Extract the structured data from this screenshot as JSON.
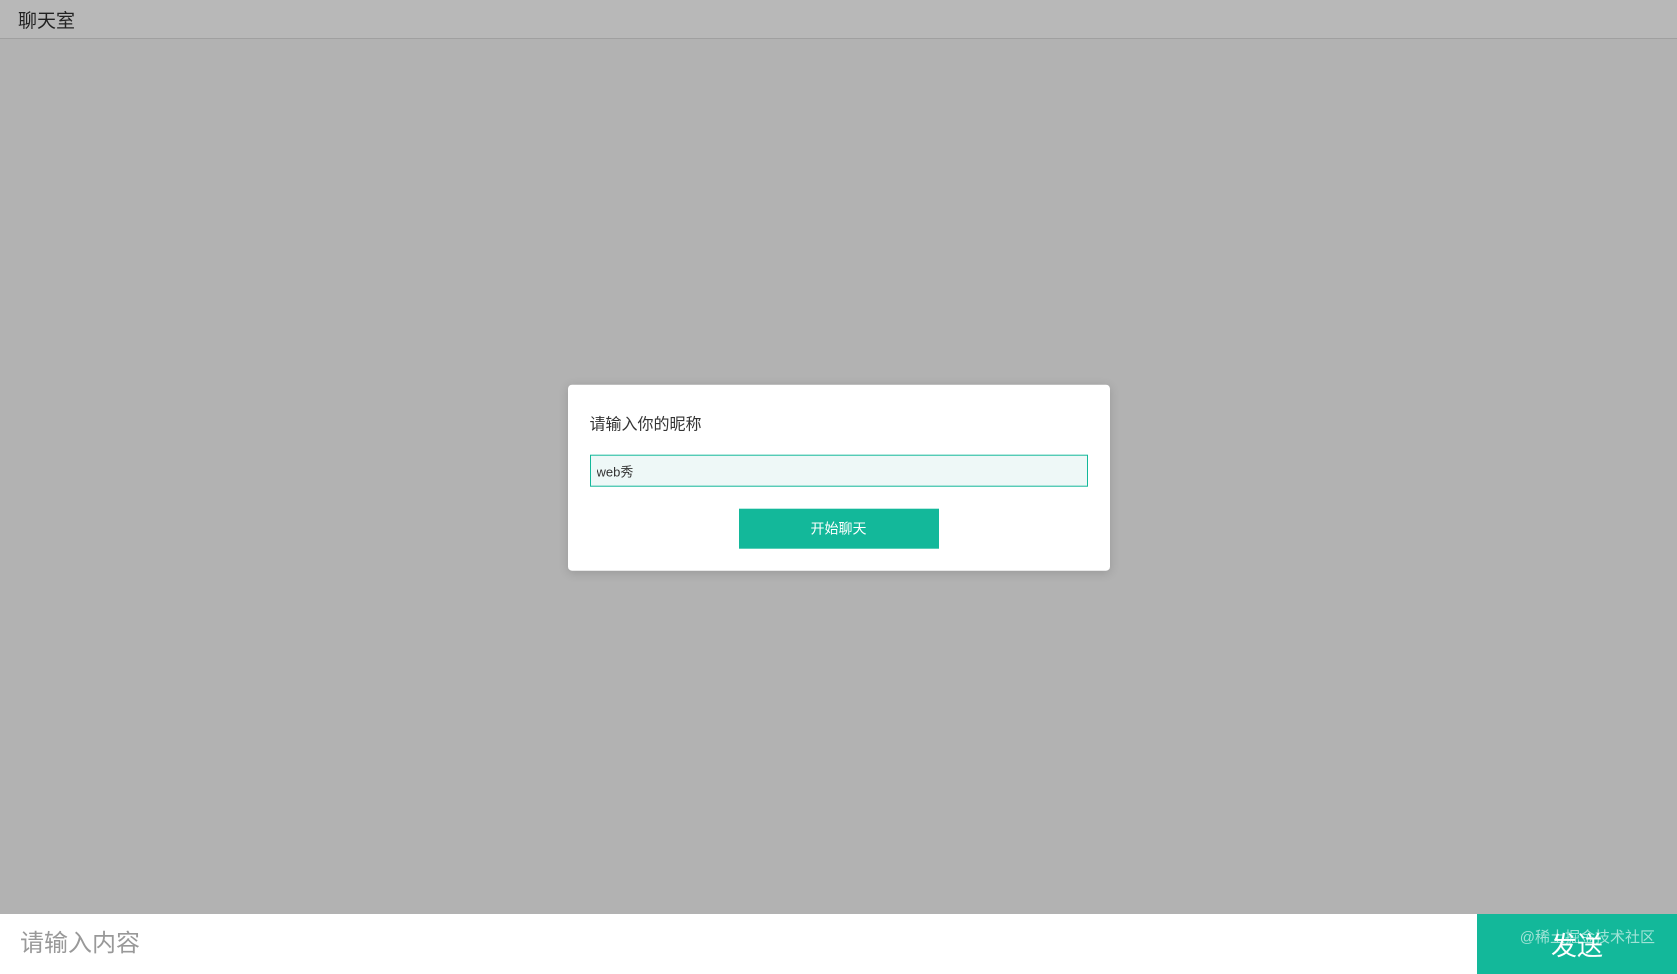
{
  "header": {
    "title": "聊天室"
  },
  "modal": {
    "title": "请输入你的昵称",
    "nickname_value": "web秀",
    "start_button_label": "开始聊天"
  },
  "bottom_bar": {
    "message_placeholder": "请输入内容",
    "send_button_label": "发送"
  },
  "watermark": {
    "text": "@稀土掘金技术社区"
  },
  "colors": {
    "accent": "#13b89a",
    "backdrop": "#b2b2b2",
    "header_bg": "#b8b8b8"
  }
}
